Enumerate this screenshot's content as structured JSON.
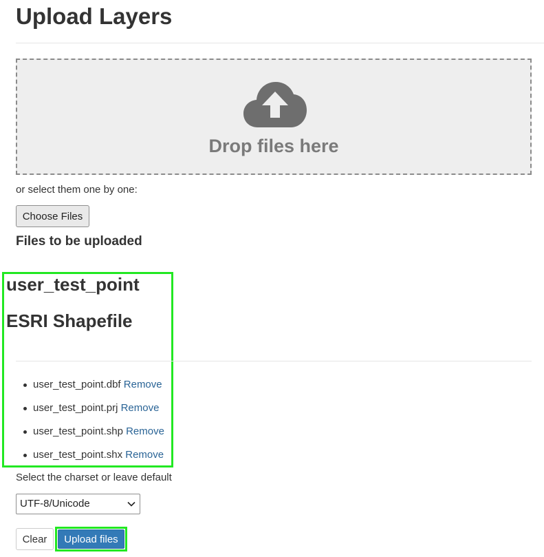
{
  "page": {
    "title": "Upload Layers"
  },
  "dropzone": {
    "icon": "cloud-upload-icon",
    "text": "Drop files here"
  },
  "select": {
    "hint": "or select them one by one:",
    "choose_label": "Choose Files"
  },
  "files_heading": "Files to be uploaded",
  "layer": {
    "name": "user_test_point",
    "type": "ESRI Shapefile",
    "files": [
      {
        "name": "user_test_point.dbf",
        "action": "Remove"
      },
      {
        "name": "user_test_point.prj",
        "action": "Remove"
      },
      {
        "name": "user_test_point.shp",
        "action": "Remove"
      },
      {
        "name": "user_test_point.shx",
        "action": "Remove"
      }
    ]
  },
  "charset": {
    "label": "Select the charset or leave default",
    "selected": "UTF-8/Unicode"
  },
  "actions": {
    "clear_label": "Clear",
    "upload_label": "Upload files"
  },
  "colors": {
    "primary": "#337ab7",
    "link": "#2a6496",
    "highlight": "#22e822",
    "dropzone_bg": "#eeeeee"
  }
}
